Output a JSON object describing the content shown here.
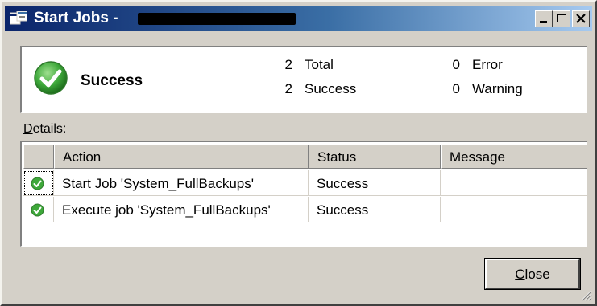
{
  "window": {
    "title": "Start Jobs - ",
    "buttons": {
      "minimize": "minimize",
      "maximize": "maximize",
      "close": "close"
    }
  },
  "summary": {
    "status": "Success",
    "total_count": "2",
    "total_label": "Total",
    "success_count": "2",
    "success_label": "Success",
    "error_count": "0",
    "error_label": "Error",
    "warning_count": "0",
    "warning_label": "Warning"
  },
  "details": {
    "label_prefix": "D",
    "label_rest": "etails:",
    "columns": [
      "Action",
      "Status",
      "Message"
    ],
    "rows": [
      {
        "action": "Start Job 'System_FullBackups'",
        "status": "Success",
        "message": ""
      },
      {
        "action": "Execute job 'System_FullBackups'",
        "status": "Success",
        "message": ""
      }
    ]
  },
  "close_button": {
    "prefix": "C",
    "rest": "lose"
  },
  "colors": {
    "titlebar_start": "#0a246a",
    "titlebar_end": "#a6caf0",
    "success_green": "#3ea83a",
    "face": "#d4d0c8"
  },
  "icons": [
    "app-window-icon",
    "success-check-icon",
    "minimize-icon",
    "maximize-icon",
    "close-icon",
    "resize-grip-icon"
  ]
}
